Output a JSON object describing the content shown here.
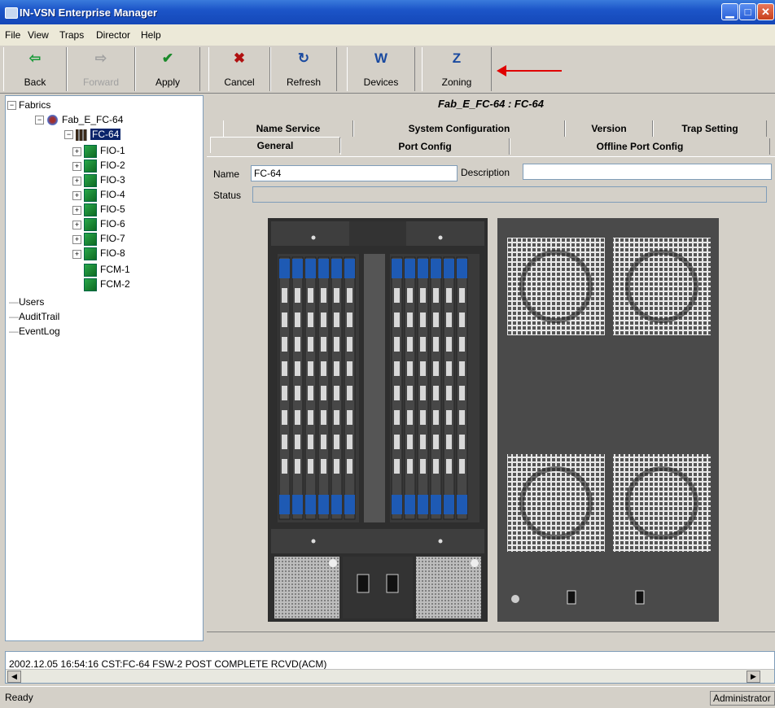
{
  "window": {
    "title": "IN-VSN Enterprise Manager"
  },
  "menu": [
    "File",
    "View",
    "Traps",
    "Director",
    "Help"
  ],
  "toolbar": [
    {
      "label": "Back",
      "icon": "⇦",
      "color": "#1a9a3a",
      "enabled": true
    },
    {
      "label": "Forward",
      "icon": "⇨",
      "color": "#a0a0a0",
      "enabled": false
    },
    {
      "label": "Apply",
      "icon": "✔",
      "color": "#1a8a2a",
      "enabled": true
    },
    {
      "label": "Cancel",
      "icon": "✖",
      "color": "#b01010",
      "enabled": true
    },
    {
      "label": "Refresh",
      "icon": "↻",
      "color": "#1a4aa0",
      "enabled": true
    },
    {
      "label": "Devices",
      "icon": "W",
      "color": "#1a4aa0",
      "enabled": true
    },
    {
      "label": "Zoning",
      "icon": "Z",
      "color": "#1a4aa0",
      "enabled": true
    }
  ],
  "tree": {
    "root": "Fabrics",
    "fabric": "Fab_E_FC-64",
    "switch": "FC-64",
    "modules": [
      "FIO-1",
      "FIO-2",
      "FIO-3",
      "FIO-4",
      "FIO-5",
      "FIO-6",
      "FIO-7",
      "FIO-8",
      "FCM-1",
      "FCM-2"
    ],
    "others": [
      "Users",
      "AuditTrail",
      "EventLog"
    ]
  },
  "panel": {
    "title": "Fab_E_FC-64 : FC-64",
    "tabs_row1": [
      "Name Service",
      "System Configuration",
      "Version",
      "Trap Setting"
    ],
    "tabs_row2": [
      "General",
      "Port Config",
      "Offline Port Config"
    ],
    "fields": {
      "name_label": "Name",
      "name_value": "FC-64",
      "description_label": "Description",
      "description_value": "",
      "status_label": "Status",
      "status_value": ""
    }
  },
  "log": {
    "message": "2002.12.05 16:54:16 CST:FC-64 FSW-2 POST COMPLETE RCVD(ACM)"
  },
  "status": {
    "left": "Ready",
    "right": "Administrator"
  },
  "colors": {
    "titlebar": "#1c55c8",
    "selection": "#0a246a",
    "chassis": "#3a3a3a",
    "port_blue": "#1e5ab4"
  }
}
